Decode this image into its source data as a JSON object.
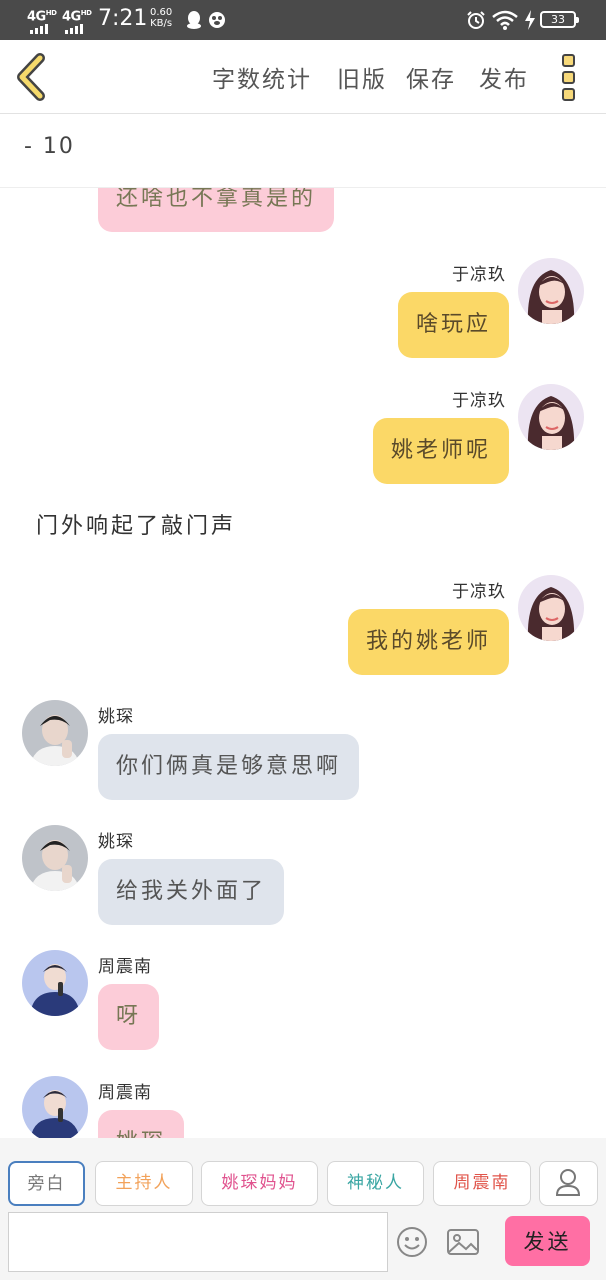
{
  "status_bar": {
    "network1": "4G",
    "network1_sup": "HD",
    "network2": "4G",
    "network2_sup": "HD",
    "time": "7:21",
    "speed_value": "0.60",
    "speed_unit": "KB/s",
    "battery": "33",
    "icons": [
      "qq-icon",
      "baidu-paw-icon",
      "alarm-icon",
      "wifi-icon",
      "charging-icon",
      "battery-icon"
    ]
  },
  "toolbar": {
    "word_count": "字数统计",
    "old_version": "旧版",
    "save": "保存",
    "publish": "发布"
  },
  "story": {
    "title": "- 10"
  },
  "messages": [
    {
      "type": "message",
      "side": "left",
      "name": "",
      "text": "还啥也不拿真是的",
      "color": "pink",
      "avatar": "purple"
    },
    {
      "type": "message",
      "side": "right",
      "name": "于凉玖",
      "text": "啥玩应",
      "color": "yellow",
      "avatar": "girl"
    },
    {
      "type": "message",
      "side": "right",
      "name": "于凉玖",
      "text": "姚老师呢",
      "color": "yellow",
      "avatar": "girl"
    },
    {
      "type": "narration",
      "text": "门外响起了敲门声"
    },
    {
      "type": "message",
      "side": "right",
      "name": "于凉玖",
      "text": "我的姚老师",
      "color": "yellow",
      "avatar": "girl"
    },
    {
      "type": "message",
      "side": "left",
      "name": "姚琛",
      "text": "你们俩真是够意思啊",
      "color": "gray",
      "avatar": "boy1"
    },
    {
      "type": "message",
      "side": "left",
      "name": "姚琛",
      "text": "给我关外面了",
      "color": "gray",
      "avatar": "boy1"
    },
    {
      "type": "message",
      "side": "left",
      "name": "周震南",
      "text": "呀",
      "color": "pink",
      "avatar": "boy2"
    },
    {
      "type": "message",
      "side": "left",
      "name": "周震南",
      "text": "姚琛",
      "color": "pink",
      "avatar": "boy2"
    }
  ],
  "roles": [
    {
      "label": "旁白",
      "color": "#777777",
      "active": true
    },
    {
      "label": "主持人",
      "color": "#f2a25a",
      "active": false
    },
    {
      "label": "姚琛妈妈",
      "color": "#e0528e",
      "active": false
    },
    {
      "label": "神秘人",
      "color": "#3aa6a3",
      "active": false
    },
    {
      "label": "周震南",
      "color": "#e0544a",
      "active": false
    }
  ],
  "input": {
    "value": "",
    "placeholder": ""
  },
  "send_label": "发送"
}
